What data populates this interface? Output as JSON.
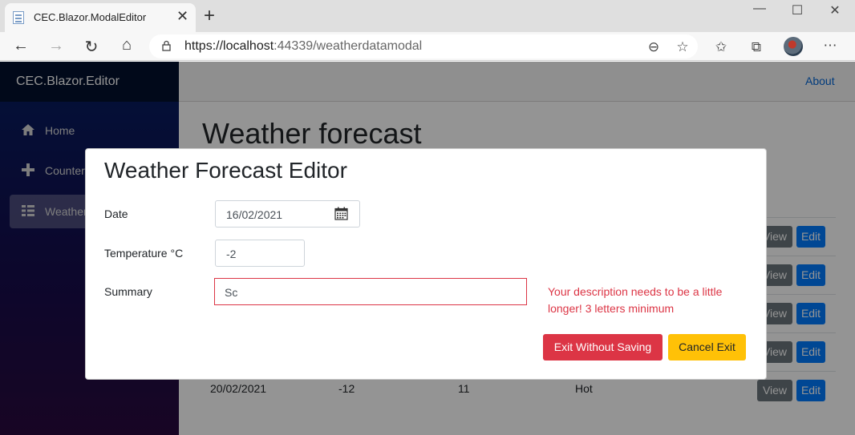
{
  "browser": {
    "tab_title": "CEC.Blazor.ModalEditor",
    "url_host": "https://localhost",
    "url_rest": ":44339/weatherdatamodal"
  },
  "app": {
    "brand": "CEC.Blazor.Editor",
    "nav": [
      {
        "label": "Home",
        "icon": "home-icon"
      },
      {
        "label": "Counter",
        "icon": "plus-icon"
      },
      {
        "label": "Weather",
        "icon": "list-icon",
        "active": true
      }
    ],
    "about": "About",
    "page_title": "Weather forecast",
    "table": {
      "last_row": {
        "date": "20/02/2021",
        "temp_c": "-12",
        "temp_f": "11",
        "summary": "Hot"
      },
      "view_label": "View",
      "edit_label": "Edit"
    }
  },
  "modal": {
    "title": "Weather Forecast Editor",
    "date_label": "Date",
    "date_value": "16/02/2021",
    "temp_label": "Temperature °C",
    "temp_value": "-2",
    "summary_label": "Summary",
    "summary_value": "Sc",
    "validation_message": "Your description needs to be a little longer! 3 letters minimum",
    "exit_button": "Exit Without Saving",
    "cancel_button": "Cancel Exit"
  },
  "colors": {
    "danger": "#dc3545",
    "warning": "#ffc107",
    "primary": "#007bff",
    "secondary": "#6c757d"
  }
}
